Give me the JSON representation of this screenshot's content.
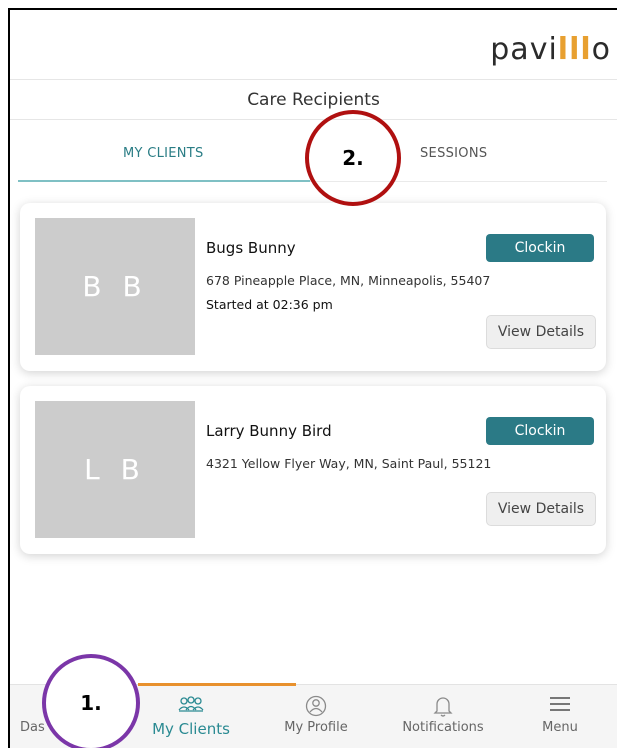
{
  "header": {
    "logo_pre": "pavi",
    "logo_mid": "lll",
    "logo_post": "o"
  },
  "title": "Care Recipients",
  "tabs": {
    "my_clients": "MY CLIENTS",
    "sessions": "SESSIONS"
  },
  "clients": [
    {
      "initials": "B B",
      "name": "Bugs Bunny",
      "address": "678 Pineapple Place, MN, Minneapolis, 55407",
      "started": "Started at 02:36 pm",
      "clockin_label": "Clockin",
      "details_label": "View Details"
    },
    {
      "initials": "L B",
      "name": "Larry Bunny Bird",
      "address": "4321 Yellow Flyer Way, MN, Saint Paul, 55121",
      "clockin_label": "Clockin",
      "details_label": "View Details"
    }
  ],
  "bottom_nav": {
    "dashboard": "Das",
    "my_clients": "My Clients",
    "my_profile": "My Profile",
    "notifications": "Notifications",
    "menu": "Menu"
  },
  "annotations": {
    "one": "1.",
    "two": "2."
  },
  "colors": {
    "accent": "#2b7a86",
    "nav_indicator": "#e8912d",
    "annotation_red": "#b01010",
    "annotation_purple": "#7b36a8"
  },
  "icons": [
    "clients-icon",
    "profile-icon",
    "bell-icon",
    "menu-icon"
  ]
}
